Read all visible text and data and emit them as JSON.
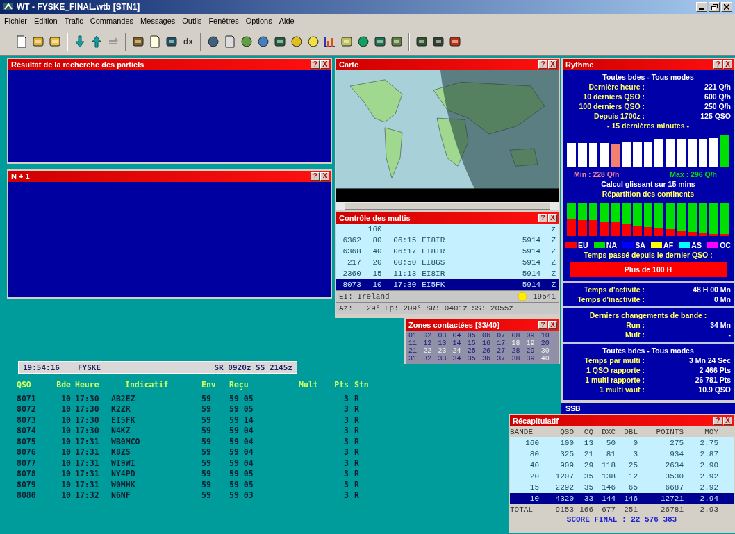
{
  "window": {
    "title": "WT - FYSKE_FINAL.wtb [STN1]"
  },
  "menu": [
    "Fichier",
    "Edition",
    "Trafic",
    "Commandes",
    "Messages",
    "Outils",
    "Fenêtres",
    "Options",
    "Aide"
  ],
  "toolbar": {
    "text_button": "dx"
  },
  "search_window": {
    "title": "Résultat de la recherche des partiels",
    "buttons": [
      "?",
      "X"
    ]
  },
  "n1_window": {
    "title": "N + 1",
    "buttons": [
      "?",
      "X"
    ]
  },
  "map_window": {
    "title": "Carte",
    "buttons": [
      "?",
      "X"
    ]
  },
  "multis_window": {
    "title": "Contrôle des multis",
    "buttons": [
      "?",
      "X"
    ],
    "rows": [
      {
        "cells": [
          "",
          "160",
          "",
          "",
          "",
          "z"
        ],
        "selected": false
      },
      {
        "cells": [
          "6362",
          "80",
          "06:15",
          "EI8IR",
          "5914",
          "Z"
        ],
        "selected": false
      },
      {
        "cells": [
          "6368",
          "40",
          "06:17",
          "EI8IR",
          "5914",
          "Z"
        ],
        "selected": false
      },
      {
        "cells": [
          "217",
          "20",
          "00:50",
          "EI8GS",
          "5914",
          "Z"
        ],
        "selected": false
      },
      {
        "cells": [
          "2360",
          "15",
          "11:13",
          "EI8IR",
          "5914",
          "Z"
        ],
        "selected": false
      },
      {
        "cells": [
          "8073",
          "10",
          "17:30",
          "EI5FK",
          "5914",
          "Z"
        ],
        "selected": true
      }
    ],
    "country": "EI: Ireland",
    "distance": "19541",
    "bearing_line": "Az:   29° Lp: 209° SR: 0401z SS: 2055z"
  },
  "zones_window": {
    "title": "Zones contactées [33/40]",
    "buttons": [
      "?",
      "X"
    ],
    "zones": [
      {
        "label": "01",
        "contacted": true
      },
      {
        "label": "02",
        "contacted": true
      },
      {
        "label": "03",
        "contacted": true
      },
      {
        "label": "04",
        "contacted": true
      },
      {
        "label": "05",
        "contacted": true
      },
      {
        "label": "06",
        "contacted": true
      },
      {
        "label": "07",
        "contacted": true
      },
      {
        "label": "08",
        "contacted": true
      },
      {
        "label": "09",
        "contacted": true
      },
      {
        "label": "10",
        "contacted": true
      },
      {
        "label": "11",
        "contacted": true
      },
      {
        "label": "12",
        "contacted": true
      },
      {
        "label": "13",
        "contacted": true
      },
      {
        "label": "14",
        "contacted": true
      },
      {
        "label": "15",
        "contacted": true
      },
      {
        "label": "16",
        "contacted": true
      },
      {
        "label": "17",
        "contacted": true
      },
      {
        "label": "18",
        "contacted": false
      },
      {
        "label": "19",
        "contacted": false
      },
      {
        "label": "20",
        "contacted": true
      },
      {
        "label": "21",
        "contacted": true
      },
      {
        "label": "22",
        "contacted": false
      },
      {
        "label": "23",
        "contacted": false
      },
      {
        "label": "24",
        "contacted": false
      },
      {
        "label": "25",
        "contacted": true
      },
      {
        "label": "26",
        "contacted": true
      },
      {
        "label": "27",
        "contacted": true
      },
      {
        "label": "28",
        "contacted": true
      },
      {
        "label": "29",
        "contacted": true
      },
      {
        "label": "30",
        "contacted": false
      },
      {
        "label": "31",
        "contacted": true
      },
      {
        "label": "32",
        "contacted": true
      },
      {
        "label": "33",
        "contacted": true
      },
      {
        "label": "34",
        "contacted": true
      },
      {
        "label": "35",
        "contacted": true
      },
      {
        "label": "36",
        "contacted": true
      },
      {
        "label": "37",
        "contacted": true
      },
      {
        "label": "38",
        "contacted": true
      },
      {
        "label": "39",
        "contacted": true
      },
      {
        "label": "40",
        "contacted": false
      }
    ]
  },
  "rythme": {
    "title": "Rythme",
    "buttons": [
      "?",
      "X"
    ],
    "header": "Toutes bdes - Tous modes",
    "stats": [
      {
        "label": "Dernière heure :",
        "value": "221 Q/h"
      },
      {
        "label": "10 derniers QSO :",
        "value": "600 Q/h"
      },
      {
        "label": "100 derniers QSO :",
        "value": "250 Q/h"
      },
      {
        "label": "Depuis 1700z :",
        "value": "125 QSO"
      }
    ],
    "subtitle": "- 15 dernières minutes -",
    "rate_bars": [
      {
        "level": 0.74,
        "color": "#ffffff"
      },
      {
        "level": 0.74,
        "color": "#ffffff"
      },
      {
        "level": 0.74,
        "color": "#ffffff"
      },
      {
        "level": 0.74,
        "color": "#ffffff"
      },
      {
        "level": 0.72,
        "color": "#f08070"
      },
      {
        "level": 0.76,
        "color": "#ffffff"
      },
      {
        "level": 0.76,
        "color": "#ffffff"
      },
      {
        "level": 0.78,
        "color": "#ffffff"
      },
      {
        "level": 0.86,
        "color": "#ffffff"
      },
      {
        "level": 0.86,
        "color": "#ffffff"
      },
      {
        "level": 0.86,
        "color": "#ffffff"
      },
      {
        "level": 0.86,
        "color": "#ffffff"
      },
      {
        "level": 0.88,
        "color": "#ffffff"
      },
      {
        "level": 0.9,
        "color": "#ffffff"
      },
      {
        "level": 1.0,
        "color": "#00e000"
      }
    ],
    "min_label": "Min : 228 Q/h",
    "max_label": "Max : 296 Q/h",
    "calc_label": "Calcul glissant sur 15 mins",
    "continents_title": "Répartition des continents",
    "continent_bars": [
      {
        "level": 0.52
      },
      {
        "level": 0.48
      },
      {
        "level": 0.48
      },
      {
        "level": 0.44
      },
      {
        "level": 0.44
      },
      {
        "level": 0.36
      },
      {
        "level": 0.3
      },
      {
        "level": 0.27
      },
      {
        "level": 0.22
      },
      {
        "level": 0.2
      },
      {
        "level": 0.16
      },
      {
        "level": 0.13
      },
      {
        "level": 0.1
      },
      {
        "level": 0.07
      },
      {
        "level": 0.07
      }
    ],
    "legend": [
      {
        "label": "EU",
        "color": "#ff0000"
      },
      {
        "label": "NA",
        "color": "#00e000"
      },
      {
        "label": "SA",
        "color": "#0000ff"
      },
      {
        "label": "AF",
        "color": "#ffff00"
      },
      {
        "label": "AS",
        "color": "#00ffff"
      },
      {
        "label": "OC",
        "color": "#ff00ff"
      }
    ],
    "last_qso_label": "Temps passé depuis le dernier QSO :",
    "last_qso_value": "Plus de 100 H",
    "activity": [
      {
        "label": "Temps d'activité :",
        "value": "48 H 00 Mn"
      },
      {
        "label": "Temps d'inactivité :",
        "value": "0 Mn"
      }
    ],
    "band_changes": {
      "title": "Derniers changements de bande :",
      "rows": [
        {
          "label": "Run :",
          "value": "34 Mn"
        },
        {
          "label": "Mult :",
          "value": "-"
        }
      ]
    },
    "summary": {
      "title": "Toutes bdes - Tous modes",
      "rows": [
        {
          "label": "Temps par multi :",
          "value": "3 Mn 24 Sec"
        },
        {
          "label": "1 QSO rapporte :",
          "value": "2 466 Pts"
        },
        {
          "label": "1 multi rapporte :",
          "value": "26 781 Pts"
        },
        {
          "label": "1 multi vaut :",
          "value": "10.9 QSO"
        }
      ]
    },
    "mode": "SSB"
  },
  "log": {
    "clock": "19:54:16",
    "station": "FYSKE",
    "sun": "SR 0920z SS 2145z",
    "columns": [
      "QSO",
      "Bde",
      "Heure",
      "Indicatif",
      "Env",
      "Reçu",
      "Mult",
      "Pts",
      "Stn"
    ],
    "rows": [
      [
        "8071",
        "10",
        "17:30",
        "AB2EZ",
        "59",
        "59 05",
        "",
        "3",
        "R"
      ],
      [
        "8072",
        "10",
        "17:30",
        "K2ZR",
        "59",
        "59 05",
        "",
        "3",
        "R"
      ],
      [
        "8073",
        "10",
        "17:30",
        "EI5FK",
        "59",
        "59 14",
        "",
        "3",
        "R"
      ],
      [
        "8074",
        "10",
        "17:30",
        "N4KZ",
        "59",
        "59 04",
        "",
        "3",
        "R"
      ],
      [
        "8075",
        "10",
        "17:31",
        "WB0MCO",
        "59",
        "59 04",
        "",
        "3",
        "R"
      ],
      [
        "8076",
        "10",
        "17:31",
        "K8ZS",
        "59",
        "59 04",
        "",
        "3",
        "R"
      ],
      [
        "8077",
        "10",
        "17:31",
        "WI9WI",
        "59",
        "59 04",
        "",
        "3",
        "R"
      ],
      [
        "8078",
        "10",
        "17:31",
        "NY4PD",
        "59",
        "59 05",
        "",
        "3",
        "R"
      ],
      [
        "8079",
        "10",
        "17:31",
        "W0MHK",
        "59",
        "59 05",
        "",
        "3",
        "R"
      ],
      [
        "8080",
        "10",
        "17:32",
        "N6NF",
        "59",
        "59 03",
        "",
        "3",
        "R"
      ]
    ]
  },
  "recap": {
    "title": "Récapitulatif",
    "buttons": [
      "?",
      "X"
    ],
    "columns": [
      "BANDE",
      "QSO",
      "CQ",
      "DXC",
      "DBL",
      "POINTS",
      "MOY"
    ],
    "rows": [
      {
        "cells": [
          "160",
          "100",
          "13",
          "50",
          "0",
          "275",
          "2.75"
        ],
        "selected": false
      },
      {
        "cells": [
          "80",
          "325",
          "21",
          "81",
          "3",
          "934",
          "2.87"
        ],
        "selected": false
      },
      {
        "cells": [
          "40",
          "909",
          "29",
          "118",
          "25",
          "2634",
          "2.90"
        ],
        "selected": false
      },
      {
        "cells": [
          "20",
          "1207",
          "35",
          "138",
          "12",
          "3530",
          "2.92"
        ],
        "selected": false
      },
      {
        "cells": [
          "15",
          "2292",
          "35",
          "146",
          "65",
          "6687",
          "2.92"
        ],
        "selected": false
      },
      {
        "cells": [
          "10",
          "4320",
          "33",
          "144",
          "146",
          "12721",
          "2.94"
        ],
        "selected": true
      }
    ],
    "total": [
      "TOTAL",
      "9153",
      "166",
      "677",
      "251",
      "26781",
      "2.93"
    ],
    "score": "SCORE FINAL : 22 576 383"
  }
}
